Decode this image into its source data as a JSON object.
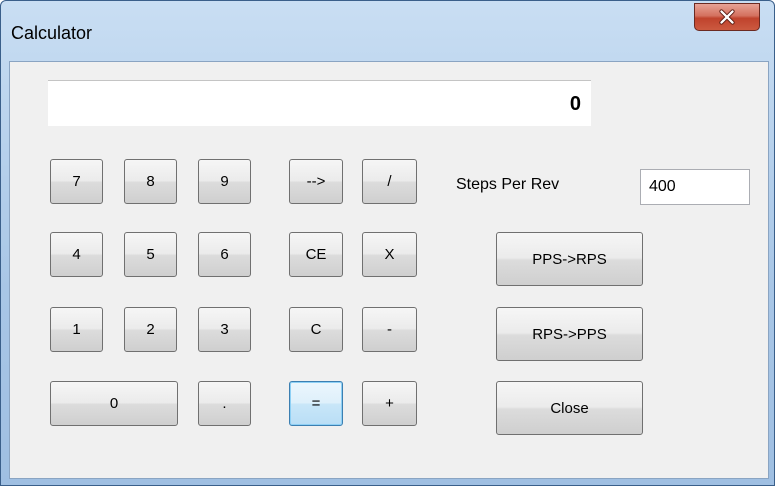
{
  "window": {
    "title": "Calculator"
  },
  "display": {
    "value": "0"
  },
  "keypad": {
    "k7": "7",
    "k8": "8",
    "k9": "9",
    "arrow": "-->",
    "divide": "/",
    "k4": "4",
    "k5": "5",
    "k6": "6",
    "ce": "CE",
    "multiply": "X",
    "k1": "1",
    "k2": "2",
    "k3": "3",
    "clear": "C",
    "minus": "-",
    "k0": "0",
    "dot": ".",
    "equals": "=",
    "plus": "+"
  },
  "settings": {
    "steps_label": "Steps Per Rev",
    "steps_value": "400"
  },
  "actions": {
    "pps_to_rps": "PPS->RPS",
    "rps_to_pps": "RPS->PPS",
    "close": "Close"
  },
  "icons": {
    "window_close": "close-icon"
  },
  "colors": {
    "titlebar": "#b4cfeb",
    "close_button": "#c0432d",
    "client_background": "#f0f0f0",
    "focus_border": "#3c7fb1"
  }
}
